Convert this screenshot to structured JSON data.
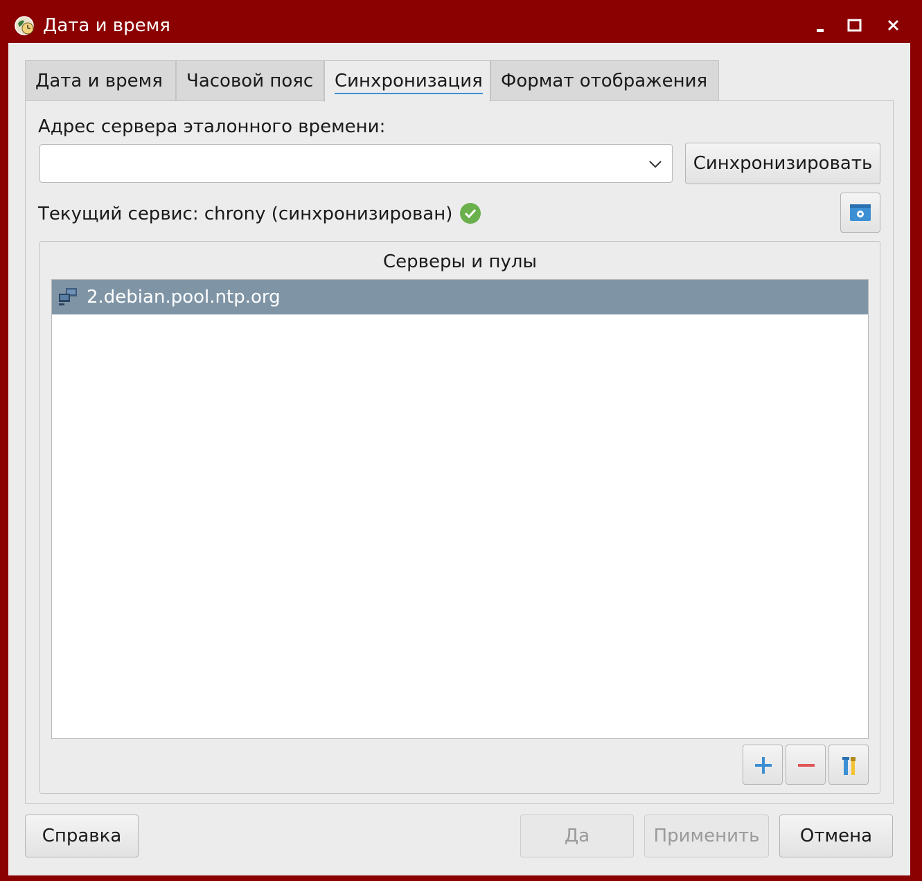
{
  "window": {
    "title": "Дата и время",
    "icon": "clock-globe-icon",
    "controls": [
      "minimize-icon",
      "maximize-icon",
      "close-icon"
    ],
    "title_color": "#8b0000"
  },
  "tabs": [
    {
      "label": "Дата и время",
      "active": false
    },
    {
      "label": "Часовой пояс",
      "active": false
    },
    {
      "label": "Синхронизация",
      "active": true
    },
    {
      "label": "Формат отображения",
      "active": false
    }
  ],
  "sync": {
    "server_label": "Адрес сервера эталонного времени:",
    "server_value": "",
    "sync_button": "Синхронизировать",
    "status_text": "Текущий сервис: chrony  (синхронизирован)",
    "status_icon": "check-circle-icon"
  },
  "servers": {
    "title": "Серверы и пулы",
    "items": [
      {
        "name": "2.debian.pool.ntp.org",
        "icon": "network-server-icon",
        "selected": true
      }
    ],
    "selection_color": "#7f95a6"
  },
  "footer": {
    "help": "Справка",
    "ok": "Да",
    "apply": "Применить",
    "cancel": "Отмена"
  }
}
